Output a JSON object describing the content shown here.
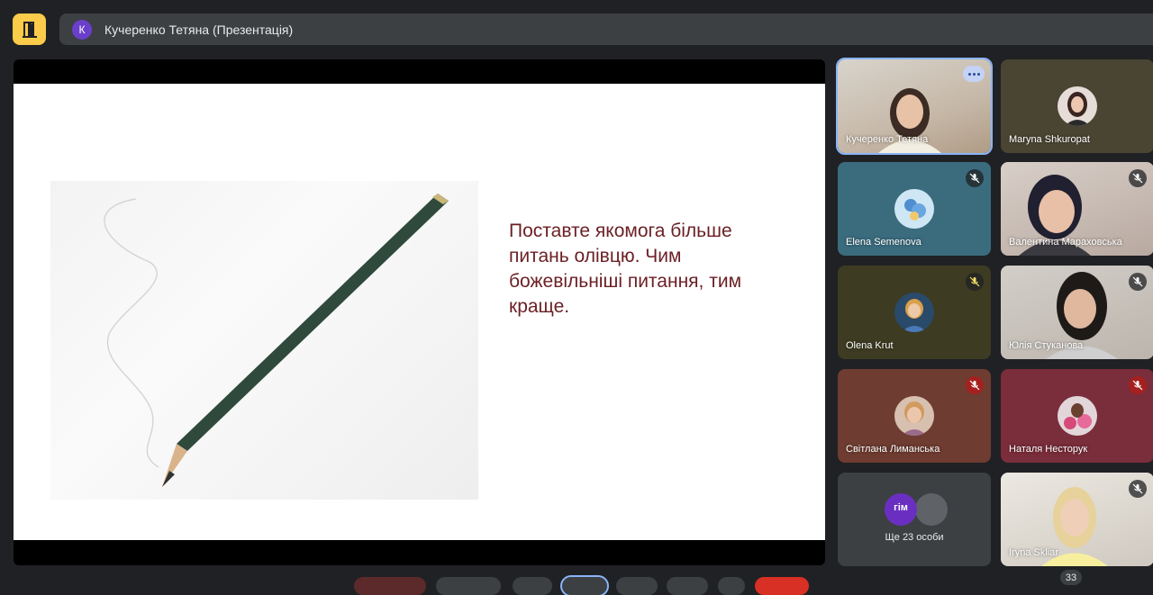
{
  "header": {
    "presenter_initial": "К",
    "title": "Кучеренко Тетяна (Презентація)"
  },
  "slide": {
    "text": "Поставте якомога більше питань олівцю. Чим божевільніші питання, тим краще."
  },
  "participants": [
    {
      "name": "Кучеренко Тетяна",
      "mic": "on",
      "speaking": true
    },
    {
      "name": "Maryna Shkuropat",
      "mic": "on"
    },
    {
      "name": "Elena Semenova",
      "mic": "off"
    },
    {
      "name": "Валентина Мараховська",
      "mic": "off"
    },
    {
      "name": "Olena Krut",
      "mic": "off"
    },
    {
      "name": "Юлія Стуканова",
      "mic": "off"
    },
    {
      "name": "Світлана Лиманська",
      "mic": "off-red"
    },
    {
      "name": "Наталя Несторук",
      "mic": "off-red"
    },
    {
      "name": "Iryna Skliar",
      "mic": "off"
    }
  ],
  "more_participants": {
    "label": "Ще 23 особи",
    "avatar_text": "гім"
  },
  "participant_count": "33",
  "colors": {
    "accent_yellow": "#fbcb4a",
    "slide_text": "#6b1f24",
    "mute_red": "#a5211f",
    "background": "#202124"
  },
  "icons": {
    "app_logo": "door-icon",
    "muted": "mic-off-icon",
    "more": "more-options-icon"
  }
}
